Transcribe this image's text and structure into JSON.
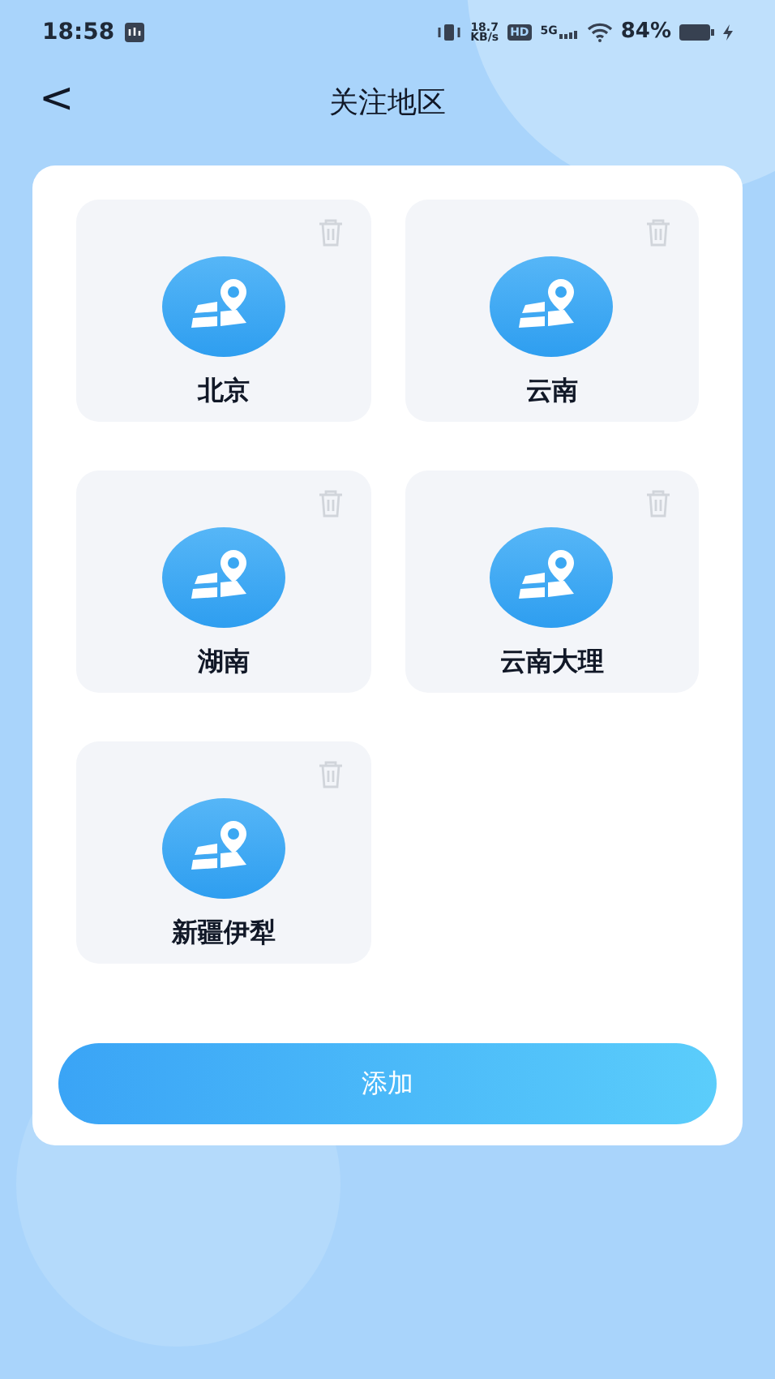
{
  "status_bar": {
    "time": "18:58",
    "net_speed_value": "18.7",
    "net_speed_unit": "KB/s",
    "hd": "HD",
    "network": "5G",
    "battery": "84%"
  },
  "header": {
    "back": "<",
    "title": "关注地区"
  },
  "regions": [
    {
      "name": "北京"
    },
    {
      "name": "云南"
    },
    {
      "name": "湖南"
    },
    {
      "name": "云南大理"
    },
    {
      "name": "新疆伊犁"
    }
  ],
  "add_button": "添加"
}
